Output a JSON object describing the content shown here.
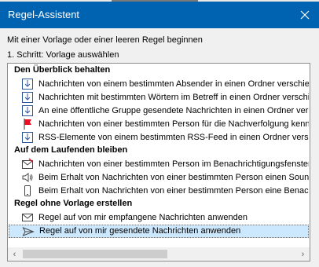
{
  "window": {
    "title": "Regel-Assistent",
    "close_icon": "close-icon"
  },
  "intro": "Mit einer Vorlage oder einer leeren Regel beginnen",
  "step": "1. Schritt: Vorlage auswählen",
  "groups": {
    "organize": "Den Überblick behalten",
    "uptodate": "Auf dem Laufenden bleiben",
    "blank": "Regel ohne Vorlage erstellen"
  },
  "items": [
    {
      "label": "Nachrichten von einem bestimmten Absender in einen Ordner verschieben",
      "icon": "move-to-folder-icon"
    },
    {
      "label": "Nachrichten mit bestimmten Wörtern im Betreff in einen Ordner verschieben",
      "icon": "move-to-folder-icon"
    },
    {
      "label": "An eine öffentliche Gruppe gesendete Nachrichten in einen Ordner verschieben",
      "icon": "move-to-folder-icon"
    },
    {
      "label": "Nachrichten von einer bestimmten Person für die Nachverfolgung kennzeichnen",
      "icon": "red-flag-icon"
    },
    {
      "label": "RSS-Elemente von einem bestimmten RSS-Feed in einen Ordner verschieben",
      "icon": "move-to-folder-icon"
    },
    {
      "label": "Nachrichten von einer bestimmten Person im Benachrichtigungsfenster für neue Elemente anzeigen",
      "icon": "alert-window-icon"
    },
    {
      "label": "Beim Erhalt von Nachrichten von einer bestimmten Person einen Sound wiedergeben",
      "icon": "speaker-icon"
    },
    {
      "label": "Beim Erhalt von Nachrichten von einer bestimmten Person eine Benachrichtigung an mein Mobilgerät senden",
      "icon": "mobile-device-icon"
    },
    {
      "label": "Regel auf von mir empfangene Nachrichten anwenden",
      "icon": "envelope-icon"
    },
    {
      "label": "Regel auf von mir gesendete Nachrichten anwenden",
      "icon": "send-arrow-icon"
    }
  ],
  "selected_item": "Regel auf von mir gesendete Nachrichten anwenden",
  "colors": {
    "titlebar": "#0063b1",
    "selection": "#cce8ff",
    "flag": "#e81123"
  }
}
